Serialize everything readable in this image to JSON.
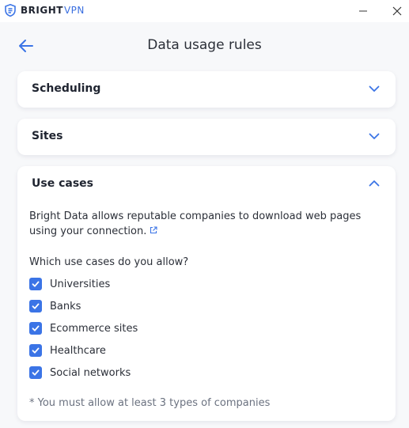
{
  "app": {
    "brand_bold": "BRIGHT",
    "brand_light": "VPN",
    "accent": "#3b74e6"
  },
  "header": {
    "title": "Data usage rules"
  },
  "sections": {
    "scheduling": {
      "title": "Scheduling",
      "expanded": false
    },
    "sites": {
      "title": "Sites",
      "expanded": false
    },
    "use_cases": {
      "title": "Use cases",
      "expanded": true,
      "description": "Bright Data allows reputable companies to download web pages using your connection.",
      "question": "Which use cases do you allow?",
      "options": [
        {
          "label": "Universities",
          "checked": true
        },
        {
          "label": "Banks",
          "checked": true
        },
        {
          "label": "Ecommerce sites",
          "checked": true
        },
        {
          "label": "Healthcare",
          "checked": true
        },
        {
          "label": "Social networks",
          "checked": true
        }
      ],
      "note": "* You must allow at least 3 types of companies"
    }
  }
}
